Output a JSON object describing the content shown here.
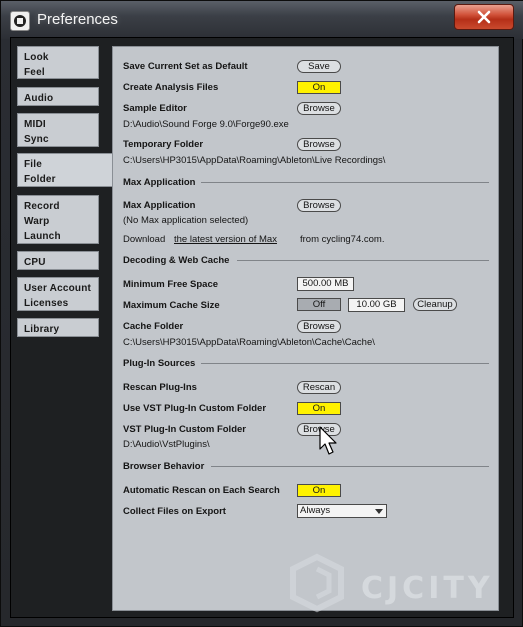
{
  "window": {
    "title": "Preferences"
  },
  "sidebar": {
    "tabs": [
      {
        "id": "look-feel",
        "lines": [
          "Look",
          "Feel"
        ]
      },
      {
        "id": "audio",
        "lines": [
          "Audio"
        ]
      },
      {
        "id": "midi-sync",
        "lines": [
          "MIDI",
          "Sync"
        ]
      },
      {
        "id": "file-folder",
        "lines": [
          "File",
          "Folder"
        ],
        "selected": true
      },
      {
        "id": "record-warp-launch",
        "lines": [
          "Record",
          "Warp",
          "Launch"
        ]
      },
      {
        "id": "cpu",
        "lines": [
          "CPU"
        ]
      },
      {
        "id": "user-account-licenses",
        "lines": [
          "User Account",
          "Licenses"
        ]
      },
      {
        "id": "library",
        "lines": [
          "Library"
        ]
      }
    ]
  },
  "file_folder": {
    "save_default": {
      "label": "Save Current Set as Default",
      "button": "Save"
    },
    "analysis": {
      "label": "Create Analysis Files",
      "value": "On"
    },
    "sample_editor": {
      "label": "Sample Editor",
      "button": "Browse",
      "path": "D:\\Audio\\Sound Forge 9.0\\Forge90.exe"
    },
    "temp_folder": {
      "label": "Temporary Folder",
      "button": "Browse",
      "path": "C:\\Users\\HP3015\\AppData\\Roaming\\Ableton\\Live Recordings\\"
    }
  },
  "max_application": {
    "header": "Max Application",
    "label": "Max Application",
    "button": "Browse",
    "status": "(No Max application selected)",
    "download_prefix": "Download",
    "download_link": "the latest version of Max",
    "download_suffix": "from cycling74.com."
  },
  "decoding_cache": {
    "header": "Decoding & Web Cache",
    "min_free_space": {
      "label": "Minimum Free Space",
      "value": "500.00 MB"
    },
    "max_cache_size": {
      "label": "Maximum Cache Size",
      "toggle": "Off",
      "value": "10.00 GB",
      "cleanup": "Cleanup"
    },
    "cache_folder": {
      "label": "Cache Folder",
      "button": "Browse",
      "path": "C:\\Users\\HP3015\\AppData\\Roaming\\Ableton\\Cache\\Cache\\"
    }
  },
  "plugin_sources": {
    "header": "Plug-In Sources",
    "rescan": {
      "label": "Rescan Plug-Ins",
      "button": "Rescan"
    },
    "use_vst_custom": {
      "label": "Use VST Plug-In Custom Folder",
      "value": "On"
    },
    "vst_custom_folder": {
      "label": "VST Plug-In Custom Folder",
      "button": "Browse",
      "path": "D:\\Audio\\VstPlugins\\"
    }
  },
  "browser_behavior": {
    "header": "Browser Behavior",
    "auto_rescan": {
      "label": "Automatic Rescan on Each Search",
      "value": "On"
    },
    "collect_files": {
      "label": "Collect Files on Export",
      "value": "Always"
    }
  },
  "watermark": {
    "text": "CJCITY"
  },
  "colors": {
    "toggle_on": "#fff200",
    "panel": "#c2c6cb",
    "close_button": "#c94a2e"
  }
}
